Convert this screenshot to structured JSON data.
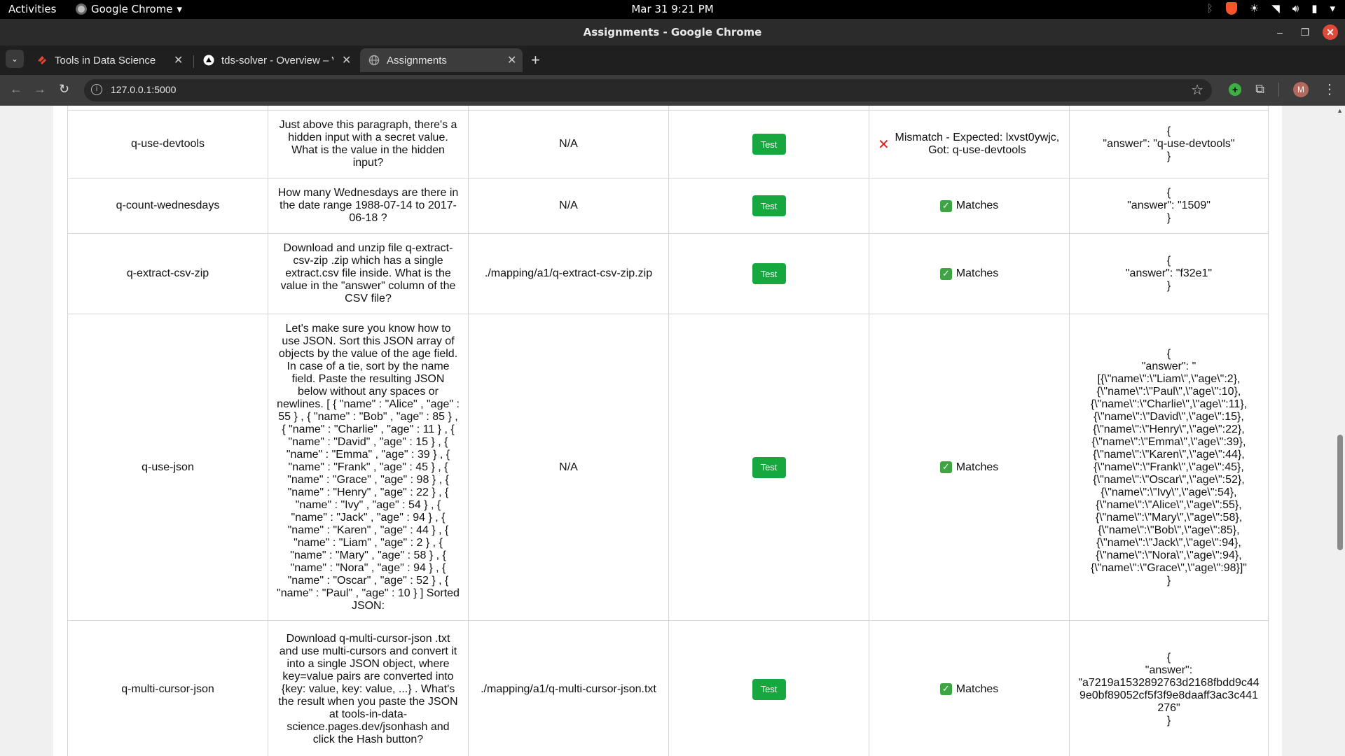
{
  "system": {
    "activities": "Activities",
    "app_name": "Google Chrome",
    "clock": "Mar 31  9:21 PM"
  },
  "window": {
    "title": "Assignments - Google Chrome"
  },
  "tabs": [
    {
      "label": "Tools in Data Science",
      "icon": "tds-logo-icon"
    },
    {
      "label": "tds-solver - Overview – V",
      "icon": "vercel-icon"
    },
    {
      "label": "Assignments",
      "icon": "globe-icon"
    }
  ],
  "address": {
    "url": "127.0.0.1:5000",
    "avatar_initial": "M"
  },
  "colors": {
    "test_button": "#17a73f",
    "match": "#3fa544",
    "mismatch": "#e0201c"
  },
  "table": {
    "rows": [
      {
        "id": "q-use-devtools",
        "question": "Just above this paragraph, there's a hidden input with a secret value. What is the value in the hidden input?",
        "file": "N/A",
        "button": "Test",
        "status_type": "mismatch",
        "status": "Mismatch - Expected: lxvst0ywjc, Got: q-use-devtools",
        "answer": "{\n\"answer\": \"q-use-devtools\"\n}"
      },
      {
        "id": "q-count-wednesdays",
        "question": "How many Wednesdays are there in the date range 1988-07-14 to 2017-06-18 ?",
        "file": "N/A",
        "button": "Test",
        "status_type": "match",
        "status": "Matches",
        "answer": "{\n\"answer\": \"1509\"\n}"
      },
      {
        "id": "q-extract-csv-zip",
        "question": "Download and unzip file q-extract-csv-zip .zip which has a single extract.csv file inside. What is the value in the \"answer\" column of the CSV file?",
        "file": "./mapping/a1/q-extract-csv-zip.zip",
        "button": "Test",
        "status_type": "match",
        "status": "Matches",
        "answer": "{\n\"answer\": \"f32e1\"\n}"
      },
      {
        "id": "q-use-json",
        "question": "Let's make sure you know how to use JSON. Sort this JSON array of objects by the value of the age field. In case of a tie, sort by the name field. Paste the resulting JSON below without any spaces or newlines. [ { \"name\" : \"Alice\" , \"age\" : 55 } , { \"name\" : \"Bob\" , \"age\" : 85 } , { \"name\" : \"Charlie\" , \"age\" : 11 } , { \"name\" : \"David\" , \"age\" : 15 } , { \"name\" : \"Emma\" , \"age\" : 39 } , { \"name\" : \"Frank\" , \"age\" : 45 } , { \"name\" : \"Grace\" , \"age\" : 98 } , { \"name\" : \"Henry\" , \"age\" : 22 } , { \"name\" : \"Ivy\" , \"age\" : 54 } , { \"name\" : \"Jack\" , \"age\" : 94 } , { \"name\" : \"Karen\" , \"age\" : 44 } , { \"name\" : \"Liam\" , \"age\" : 2 } , { \"name\" : \"Mary\" , \"age\" : 58 } , { \"name\" : \"Nora\" , \"age\" : 94 } , { \"name\" : \"Oscar\" , \"age\" : 52 } , { \"name\" : \"Paul\" , \"age\" : 10 } ] Sorted JSON:",
        "file": "N/A",
        "button": "Test",
        "status_type": "match",
        "status": "Matches",
        "answer": "{\n\"answer\": \"\n[{\\\"name\\\":\\\"Liam\\\",\\\"age\\\":2},\n{\\\"name\\\":\\\"Paul\\\",\\\"age\\\":10},\n{\\\"name\\\":\\\"Charlie\\\",\\\"age\\\":11},\n{\\\"name\\\":\\\"David\\\",\\\"age\\\":15},\n{\\\"name\\\":\\\"Henry\\\",\\\"age\\\":22},\n{\\\"name\\\":\\\"Emma\\\",\\\"age\\\":39},\n{\\\"name\\\":\\\"Karen\\\",\\\"age\\\":44},\n{\\\"name\\\":\\\"Frank\\\",\\\"age\\\":45},\n{\\\"name\\\":\\\"Oscar\\\",\\\"age\\\":52},\n{\\\"name\\\":\\\"Ivy\\\",\\\"age\\\":54},\n{\\\"name\\\":\\\"Alice\\\",\\\"age\\\":55},\n{\\\"name\\\":\\\"Mary\\\",\\\"age\\\":58},\n{\\\"name\\\":\\\"Bob\\\",\\\"age\\\":85},\n{\\\"name\\\":\\\"Jack\\\",\\\"age\\\":94},\n{\\\"name\\\":\\\"Nora\\\",\\\"age\\\":94},\n{\\\"name\\\":\\\"Grace\\\",\\\"age\\\":98}]\"\n}"
      },
      {
        "id": "q-multi-cursor-json",
        "question": "Download q-multi-cursor-json .txt and use multi-cursors and convert it into a single JSON object, where key=value pairs are converted into {key: value, key: value, ...} . What's the result when you paste the JSON at tools-in-data-science.pages.dev/jsonhash and click the Hash button?",
        "file": "./mapping/a1/q-multi-cursor-json.txt",
        "button": "Test",
        "status_type": "match",
        "status": "Matches",
        "answer": "{\n\"answer\":\n\"a7219a1532892763d2168fbdd9c44\n9e0bf89052cf5f3f9e8daaff3ac3c441\n276\"\n}"
      }
    ]
  }
}
